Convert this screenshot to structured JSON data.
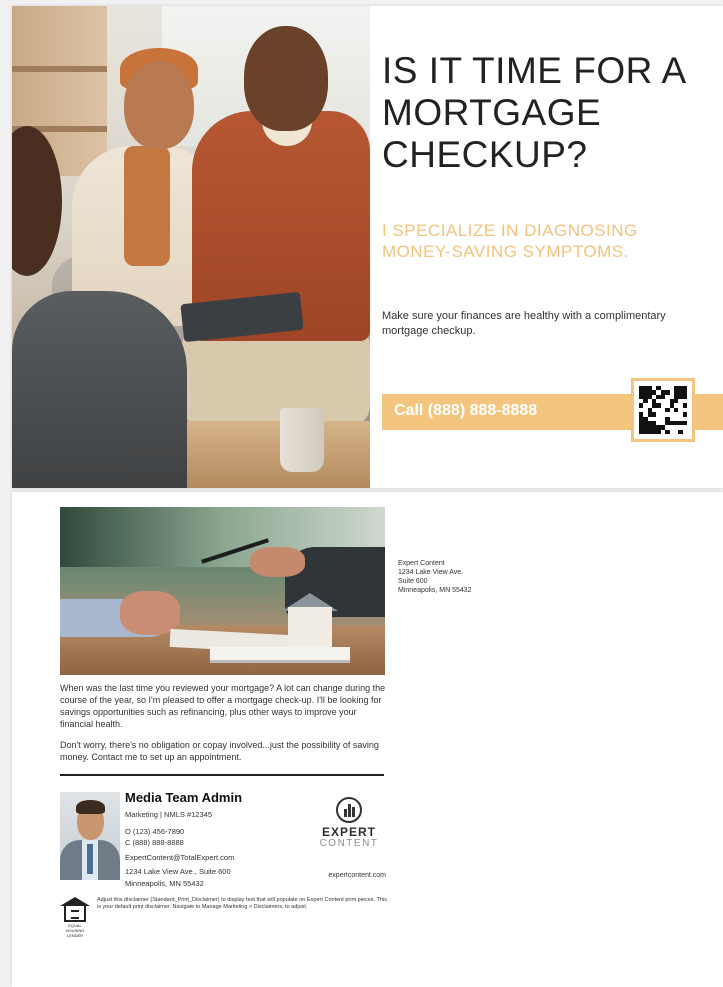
{
  "front": {
    "headline": "IS IT TIME FOR A MORTGAGE CHECKUP?",
    "subhead": "I SPECIALIZE IN DIAGNOSING MONEY-SAVING SYMPTOMS.",
    "body": "Make sure your finances are healthy with a complimentary mortgage checkup.",
    "call": "Call (888) 888-8888",
    "accent_color": "#f3c57f"
  },
  "back": {
    "return_address": {
      "company": "Expert Content",
      "street": "1234 Lake View Ave.",
      "suite": "Suite 600",
      "city": "Minneapolis, MN 55432"
    },
    "paragraphs": [
      "When was the last time you reviewed your mortgage? A lot can change during the course of the year, so I'm pleased to offer a mortgage check-up. I'll be looking for savings opportunities such as refinancing, plus other ways to improve your financial health.",
      "Don't worry, there's no obligation or copay involved...just the possibility of saving money. Contact me to set up an appointment."
    ],
    "agent": {
      "name": "Media Team Admin",
      "title": "Marketing | NMLS #12345",
      "office": "O (123) 456-7890",
      "cell": "C (888) 888-8888",
      "email": "ExpertContent@TotalExpert.com",
      "address1": "1234 Lake View Ave., Suite 600",
      "address2": "Minneapolis, MN 55432"
    },
    "logo": {
      "line1": "EXPERT",
      "line2": "CONTENT"
    },
    "website": "expertcontent.com",
    "eho_label": "EQUAL HOUSING LENDER",
    "disclaimer": "Adjust this disclaimer (Standard_Print_Disclaimer) to display text that will populate on Expert Content print pieces. This is your default print disclaimer. Navigate to Manage Marketing > Disclaimers, to adjust."
  }
}
